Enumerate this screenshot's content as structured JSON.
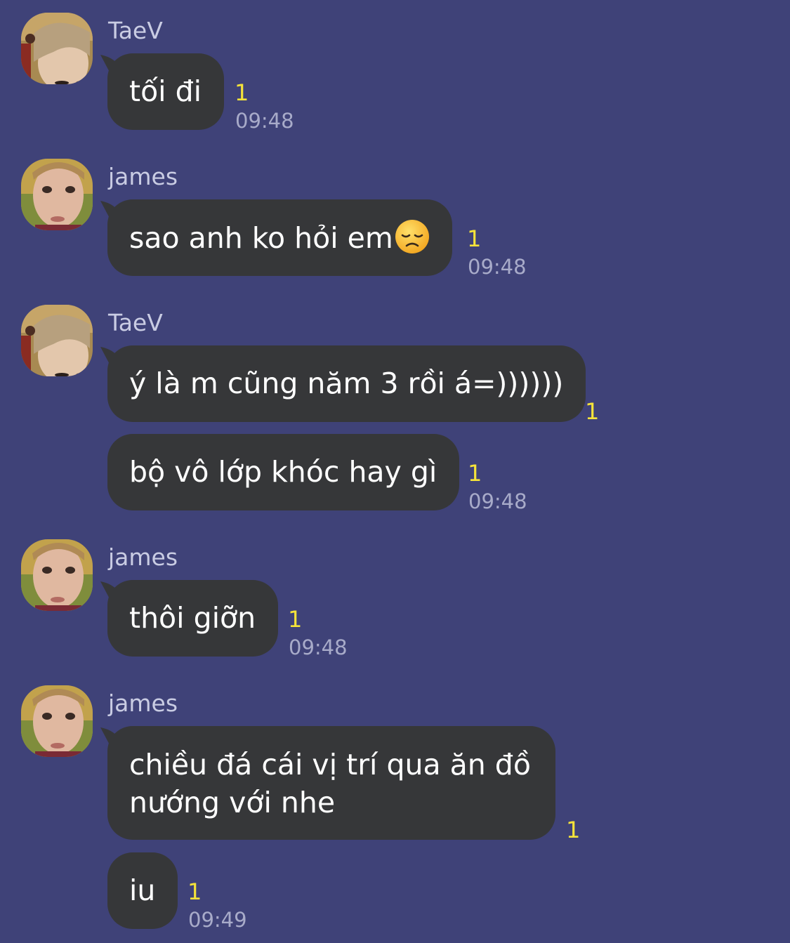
{
  "colors": {
    "background": "#3f4278",
    "bubble": "#363739",
    "bubble_text": "#ffffff",
    "sender_name": "#c9cce3",
    "unread": "#f5e33a",
    "timestamp": "#a8abc9"
  },
  "senders": {
    "taev": "TaeV",
    "james": "james"
  },
  "messages": [
    {
      "sender": "TaeV",
      "text": "tối đi",
      "unread": "1",
      "time": "09:48"
    },
    {
      "sender": "james",
      "text": "sao anh ko hỏi em",
      "emoji": "disappointed-face-icon",
      "unread": "1",
      "time": "09:48"
    },
    {
      "sender": "TaeV",
      "text": "ý là m cũng năm 3 rồi á=))))))",
      "unread": "1"
    },
    {
      "text": "bộ vô lớp khóc hay gì",
      "unread": "1",
      "time": "09:48"
    },
    {
      "sender": "james",
      "text": "thôi giỡn",
      "unread": "1",
      "time": "09:48"
    },
    {
      "sender": "james",
      "text": "chiều đá cái vị trí qua ăn đồ nướng với nhe",
      "unread": "1"
    },
    {
      "text": "iu",
      "unread": "1",
      "time": "09:49"
    }
  ]
}
